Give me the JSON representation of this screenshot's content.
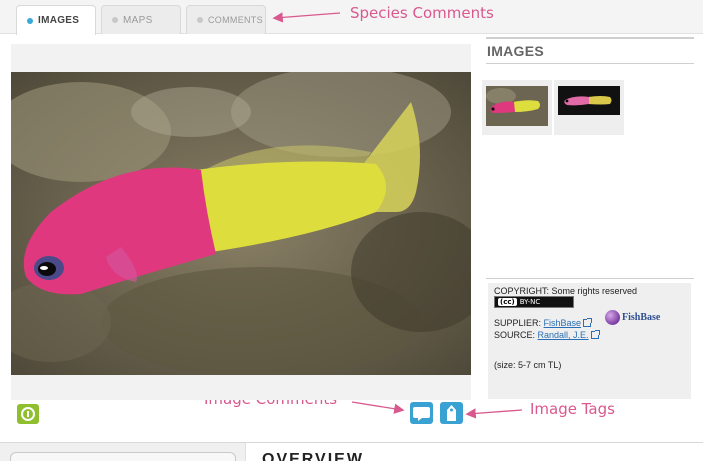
{
  "tabs": [
    {
      "label": "IMAGES",
      "active": true
    },
    {
      "label": "MAPS",
      "active": false
    },
    {
      "label": "COMMENTS",
      "active": false
    }
  ],
  "annotations": {
    "species_comments": "Species Comments",
    "image_comments": "Image Comments",
    "image_tags": "Image Tags"
  },
  "right_column": {
    "heading": "IMAGES",
    "thumbnails": [
      "fish-photo-thumbnail",
      "fish-photo-thumbnail"
    ]
  },
  "credits": {
    "copyright": "COPYRIGHT: Some rights reserved",
    "license_badge_cc": "(cc)",
    "license_badge_text": "BY-NC",
    "supplier_label": "SUPPLIER:",
    "supplier_link": "FishBase",
    "logo_text": "FishBase",
    "source_label": "SOURCE:",
    "source_link": "Randall, J.E.",
    "size_note": "(size: 5-7 cm TL)"
  },
  "bottom": {
    "section_title": "OVERVIEW"
  },
  "colors": {
    "accent_blue": "#3aa2d3",
    "annotation_pink": "#d9588e",
    "info_green": "#8fbf2e",
    "fish_magenta": "#e0387f",
    "fish_yellow": "#dedd3e"
  },
  "icons": {
    "info": "info-icon",
    "comment": "speech-bubble-icon",
    "tag": "tag-icon",
    "external_link": "external-link-icon"
  }
}
